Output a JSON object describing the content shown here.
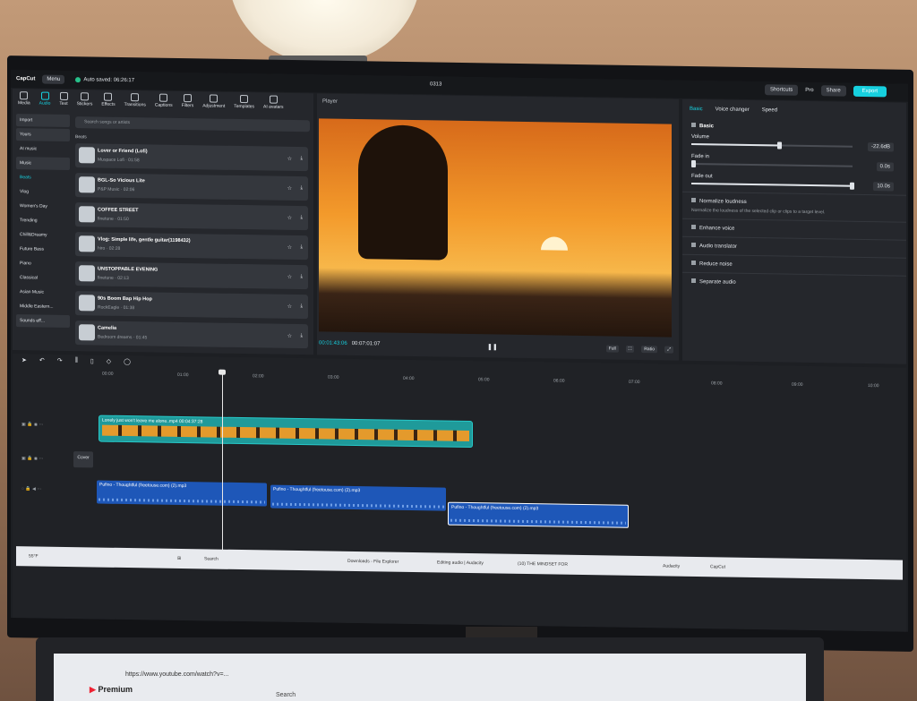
{
  "app": {
    "logo": "CapCut",
    "menu_label": "Menu",
    "autosave": "Auto saved: 06:26:17",
    "project_title": "0313"
  },
  "top_right": {
    "shortcuts": "Shortcuts",
    "pro": "Pro",
    "share": "Share",
    "export": "Export"
  },
  "media_tabs": [
    "Media",
    "Audio",
    "Text",
    "Stickers",
    "Effects",
    "Transitions",
    "Captions",
    "Filters",
    "Adjustment",
    "Templates",
    "AI avatars"
  ],
  "audio_categories": [
    "Import",
    "Yours",
    "AI music",
    "Music",
    "Beats",
    "Vlog",
    "Women's Day",
    "Trending",
    "Chill&Dreamy",
    "Future Bass",
    "Piano",
    "Classical",
    "Asian Music",
    "Middle Eastern...",
    "Sounds eff..."
  ],
  "search_placeholder": "Search songs or artists",
  "beats_heading": "Beats",
  "songs": [
    {
      "title": "Lover or Friend (Lofi)",
      "meta": "Muspace Lofi · 01:58"
    },
    {
      "title": "BGL-So Vicious Lite",
      "meta": "P&P Music · 02:06"
    },
    {
      "title": "COFFEE STREET",
      "meta": "finetune · 01:50"
    },
    {
      "title": "Vlog: Simple life, gentle guitar(1198432)",
      "meta": "hiro · 02:28"
    },
    {
      "title": "UNSTOPPABLE EVENING",
      "meta": "finetune · 02:13"
    },
    {
      "title": "90s Boom Bap Hip Hop",
      "meta": "RockEagle · 01:38"
    },
    {
      "title": "Camelia",
      "meta": "Bedroom dreams · 01:45"
    }
  ],
  "player": {
    "heading": "Player",
    "current_time": "00:01:43:06",
    "total_time": "00:07:01:07",
    "full": "Full",
    "ratio": "Ratio"
  },
  "right_panel": {
    "tabs": [
      "Basic",
      "Voice changer",
      "Speed"
    ],
    "basic_section": "Basic",
    "volume_label": "Volume",
    "volume_value": "-22.6dB",
    "volume_level": 0.55,
    "fade_in_label": "Fade in",
    "fade_in_value": "0.0s",
    "fade_in_level": 0.0,
    "fade_out_label": "Fade out",
    "fade_out_value": "10.0s",
    "fade_out_level": 1.0,
    "normalize_label": "Normalize loudness",
    "normalize_desc": "Normalize the loudness of the selected clip or clips to a target level.",
    "enhance_voice": "Enhance voice",
    "audio_translator": "Audio translator",
    "reduce_noise": "Reduce noise",
    "separate_audio": "Separate audio"
  },
  "timeline": {
    "ruler": [
      "00:00",
      "01:00",
      "02:00",
      "03:00",
      "04:00",
      "05:00",
      "06:00",
      "07:00",
      "08:00",
      "09:00",
      "10:00"
    ],
    "video_clip": "Lonely just won't leave me alone..mp4  00:04:37:28",
    "cover_label": "Cover",
    "audio_clips": [
      "Pufino - Thoughtful (freetouse.com) (2).mp3",
      "Pufino - Thoughtful (freetouse.com) (2).mp3",
      "Pufino - Thoughtful (freetouse.com) (2).mp3"
    ]
  },
  "taskbar": {
    "weather": "55°F",
    "search": "Search",
    "downloads": "Downloads - File Explorer",
    "audacity": "Editing audio | Audacity",
    "mindset": "(10) THE MINDSET FOR",
    "audacity2": "Audacity",
    "capcut": "CapCut"
  },
  "laptop": {
    "url": "https://www.youtube.com/watch?v=...",
    "youtube": "Premium",
    "search": "Search"
  }
}
